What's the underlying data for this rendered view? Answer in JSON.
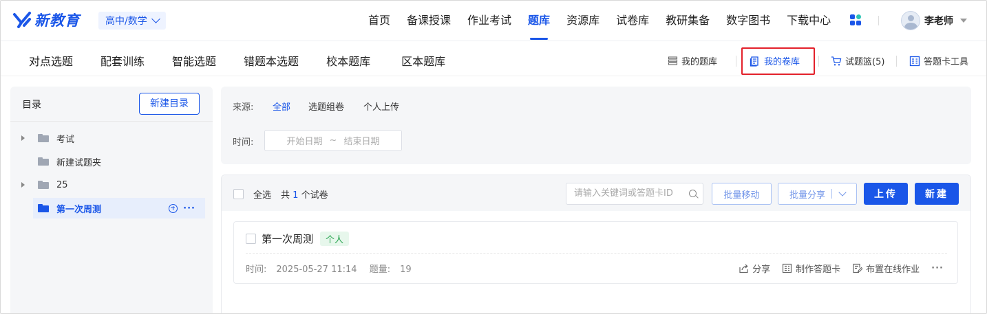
{
  "brand": {
    "name": "新教育",
    "color": "#1a56e8"
  },
  "grade_select": {
    "value": "高中/数学"
  },
  "nav": [
    {
      "label": "首页"
    },
    {
      "label": "备课授课"
    },
    {
      "label": "作业考试"
    },
    {
      "label": "题库",
      "active": true
    },
    {
      "label": "资源库"
    },
    {
      "label": "试卷库"
    },
    {
      "label": "教研集备"
    },
    {
      "label": "数字图书"
    },
    {
      "label": "下载中心"
    }
  ],
  "user": {
    "name": "李老师"
  },
  "sub_tabs": [
    {
      "label": "对点选题"
    },
    {
      "label": "配套训练"
    },
    {
      "label": "智能选题"
    },
    {
      "label": "错题本选题"
    },
    {
      "label": "校本题库"
    },
    {
      "label": "区本题库"
    }
  ],
  "tools": {
    "my_bank": "我的题库",
    "my_papers": "我的卷库",
    "basket": "试题篮(5)",
    "answer_card": "答题卡工具"
  },
  "sidebar": {
    "title": "目录",
    "new_dir_label": "新建目录",
    "items": [
      {
        "label": "考试",
        "expandable": true
      },
      {
        "label": "新建试题夹",
        "expandable": false
      },
      {
        "label": "25",
        "expandable": true
      },
      {
        "label": "第一次周测",
        "selected": true
      }
    ]
  },
  "filters": {
    "source_label": "来源:",
    "source_options": [
      "全部",
      "选题组卷",
      "个人上传"
    ],
    "source_selected": "全部",
    "time_label": "时间:",
    "start_placeholder": "开始日期",
    "range_sep": "~",
    "end_placeholder": "结束日期"
  },
  "list": {
    "select_all": "全选",
    "count_prefix": "共",
    "count": "1",
    "count_suffix": "个试卷",
    "search_placeholder": "请输入关键词或答题卡ID",
    "batch_move": "批量移动",
    "batch_share": "批量分享",
    "upload": "上传",
    "create": "新建"
  },
  "papers": [
    {
      "title": "第一次周测",
      "tag": "个人",
      "time_label": "时间:",
      "time": "2025-05-27 11:14",
      "qcount_label": "题量:",
      "qcount": "19",
      "actions": {
        "share": "分享",
        "make_card": "制作答题卡",
        "assign": "布置在线作业",
        "more": "···"
      }
    }
  ],
  "colors": {
    "accent": "#1a56e8",
    "highlight": "#e3202a",
    "tag_green": "#2aa551"
  }
}
